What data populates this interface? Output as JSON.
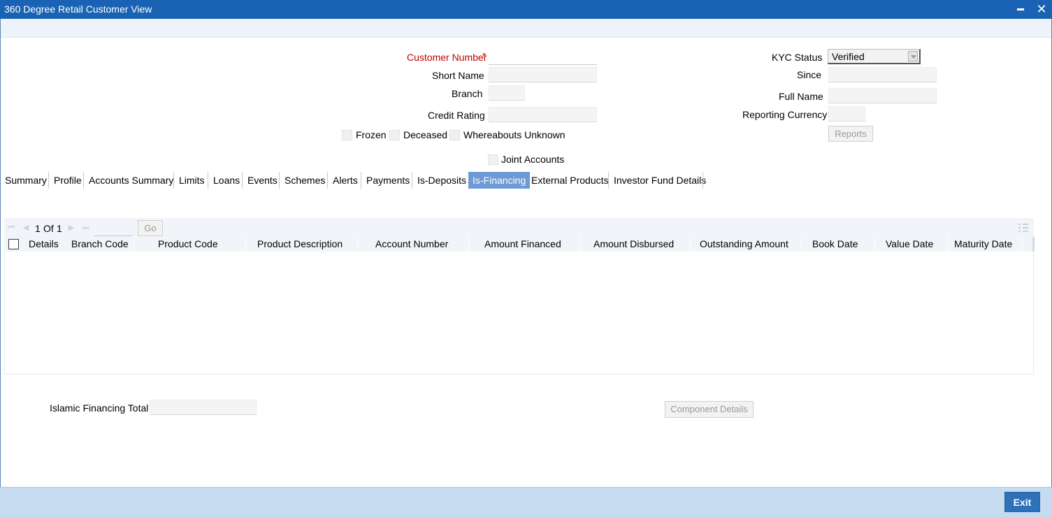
{
  "window": {
    "title": "360 Degree Retail Customer View",
    "minimize_icon": "minimize-icon",
    "close_icon": "close-icon",
    "close_glyph": "✕"
  },
  "form": {
    "customer_number_label": "Customer Number",
    "required_marker": "*",
    "customer_number_value": "",
    "short_name_label": "Short Name",
    "branch_label": "Branch",
    "credit_rating_label": "Credit Rating",
    "frozen_label": "Frozen",
    "deceased_label": "Deceased",
    "whereabouts_label": "Whereabouts Unknown",
    "joint_accounts_label": "Joint Accounts",
    "kyc_status_label": "KYC Status",
    "kyc_status_value": "Verified",
    "since_label": "Since",
    "full_name_label": "Full Name",
    "reporting_currency_label": "Reporting Currency",
    "reports_button": "Reports"
  },
  "tabs": [
    {
      "label": "Summary"
    },
    {
      "label": "Profile"
    },
    {
      "label": "Accounts Summary"
    },
    {
      "label": "Limits"
    },
    {
      "label": "Loans"
    },
    {
      "label": "Events"
    },
    {
      "label": "Schemes"
    },
    {
      "label": "Alerts"
    },
    {
      "label": "Payments"
    },
    {
      "label": "Is-Deposits"
    },
    {
      "label": "Is-Financing",
      "active": true
    },
    {
      "label": "External Products"
    },
    {
      "label": "Investor Fund Details"
    }
  ],
  "grid": {
    "page_current": "1",
    "page_of": "Of",
    "page_total": "1",
    "go_button": "Go",
    "columns": [
      "Details",
      "Branch Code",
      "Product Code",
      "Product Description",
      "Account Number",
      "Amount Financed",
      "Amount Disbursed",
      "Outstanding Amount",
      "Book Date",
      "Value Date",
      "Maturity Date"
    ],
    "rows": []
  },
  "totals": {
    "islamic_financing_total_label": "Islamic Financing Total",
    "islamic_financing_total_value": "",
    "component_details_button": "Component Details"
  },
  "footer": {
    "exit_button": "Exit"
  },
  "colors": {
    "title_bar": "#1a63b4",
    "active_tab": "#6d9ad3",
    "required_label": "#c00000",
    "footer": "#c5dcf0",
    "exit_button": "#2e71b8"
  }
}
